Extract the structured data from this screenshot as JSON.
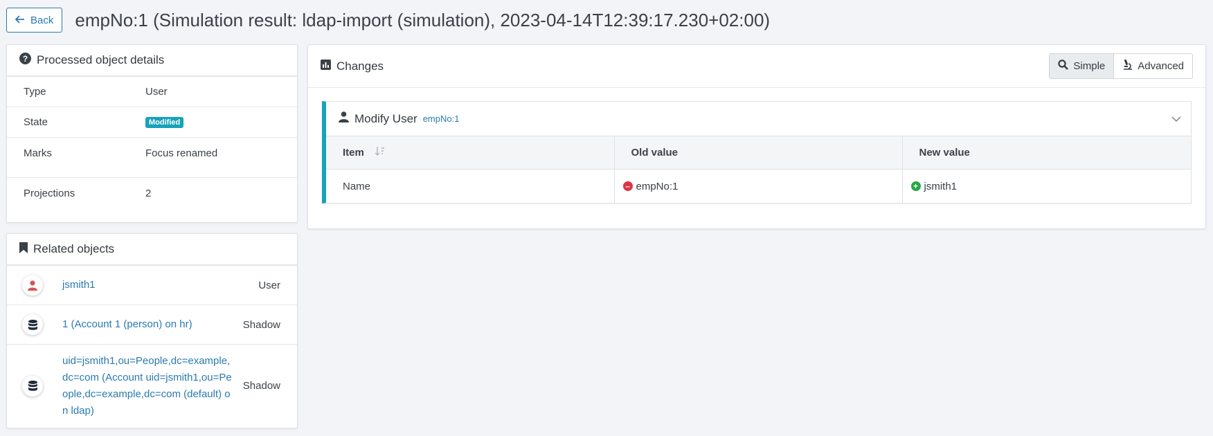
{
  "header": {
    "back_label": "Back",
    "title": "empNo:1 (Simulation result: ldap-import (simulation), 2023-04-14T12:39:17.230+02:00)"
  },
  "details": {
    "title": "Processed object details",
    "rows": [
      {
        "key": "Type",
        "value": "User"
      },
      {
        "key": "State",
        "value": "Modified"
      },
      {
        "key": "Marks",
        "value": "Focus renamed"
      },
      {
        "key": "Projections",
        "value": "2"
      }
    ]
  },
  "related": {
    "title": "Related objects",
    "items": [
      {
        "name": "jsmith1",
        "type": "User",
        "icon": "user-icon"
      },
      {
        "name": "1 (Account 1 (person) on hr)",
        "type": "Shadow",
        "icon": "database-icon"
      },
      {
        "name": "uid=jsmith1,ou=People,dc=example,dc=com (Account uid=jsmith1,ou=People,dc=example,dc=com (default) on ldap)",
        "type": "Shadow",
        "icon": "database-icon"
      }
    ]
  },
  "changes": {
    "title": "Changes",
    "toggle": {
      "simple": "Simple",
      "advanced": "Advanced",
      "active": "simple"
    },
    "delta": {
      "title": "Modify User",
      "oid": "empNo:1",
      "columns": [
        "Item",
        "Old value",
        "New value"
      ],
      "rows": [
        {
          "item": "Name",
          "old": "empNo:1",
          "new": "jsmith1"
        }
      ]
    }
  },
  "colors": {
    "accent": "#2a7ab0",
    "info": "#17a2b8",
    "danger": "#dc3545",
    "success": "#28a745"
  }
}
